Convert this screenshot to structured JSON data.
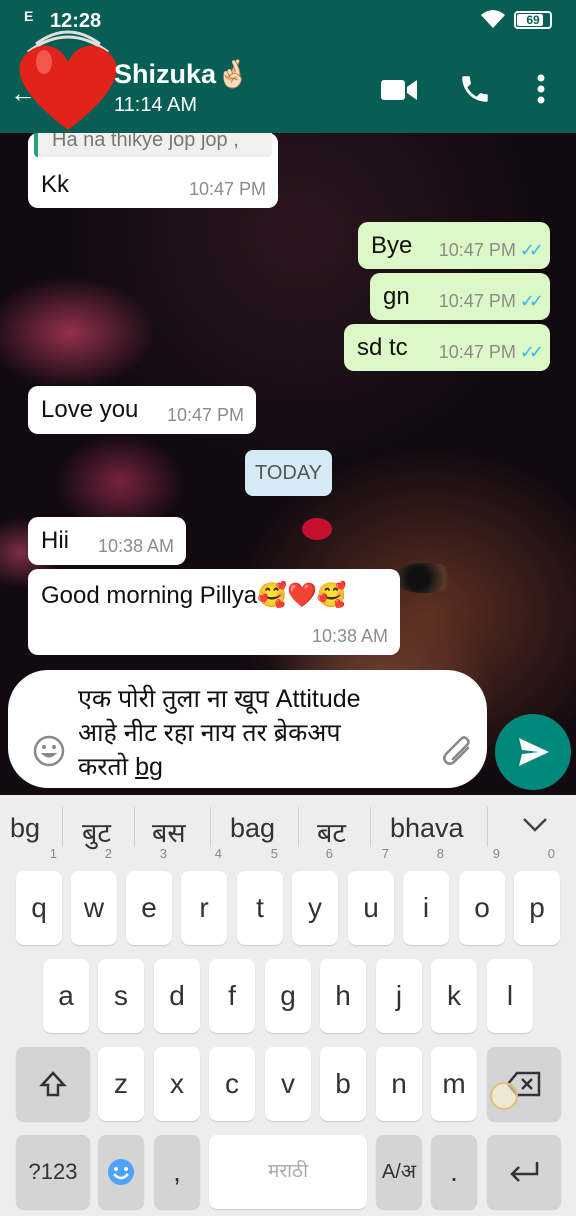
{
  "status_bar": {
    "time": "12:28",
    "signal": "E",
    "battery": "69"
  },
  "header": {
    "contact_name": "Shizuka🤞🏻",
    "last_seen": "11:14 AM",
    "icons": [
      "back-arrow-icon",
      "heart-icon",
      "video-call-icon",
      "voice-call-icon",
      "more-options-icon"
    ]
  },
  "chat": {
    "messages": [
      {
        "dir": "in",
        "quote": "Ha na thikye jop jop ,",
        "text": "Kk",
        "time": "10:47 PM"
      },
      {
        "dir": "out",
        "text": "Bye",
        "time": "10:47 PM",
        "ticks": "✓✓"
      },
      {
        "dir": "out",
        "text": "gn",
        "time": "10:47 PM",
        "ticks": "✓✓"
      },
      {
        "dir": "out",
        "text": "sd tc",
        "time": "10:47 PM",
        "ticks": "✓✓"
      },
      {
        "dir": "in",
        "text": "Love you",
        "time": "10:47 PM"
      },
      {
        "dir": "in",
        "text": "Hii",
        "time": "10:38 AM"
      },
      {
        "dir": "in",
        "text": "Good morning Pillya🥰❤️🥰",
        "time": "10:38 AM"
      }
    ],
    "date_divider": "TODAY"
  },
  "composer": {
    "line1": "एक पोरी तुला ना खूप Attitude",
    "line2": "आहे नीट रहा नाय तर ब्रेकअप",
    "line3_prefix": "करतो ",
    "line3_word": "bg"
  },
  "keyboard": {
    "suggestions": [
      "bg",
      "बुट",
      "बस",
      "bag",
      "बट",
      "bhava"
    ],
    "row1": [
      "q",
      "w",
      "e",
      "r",
      "t",
      "y",
      "u",
      "i",
      "o",
      "p"
    ],
    "row1_hints": [
      "1",
      "2",
      "3",
      "4",
      "5",
      "6",
      "7",
      "8",
      "9",
      "0"
    ],
    "row2": [
      "a",
      "s",
      "d",
      "f",
      "g",
      "h",
      "j",
      "k",
      "l"
    ],
    "row3": [
      "z",
      "x",
      "c",
      "v",
      "b",
      "n",
      "m"
    ],
    "symbols_label": "?123",
    "comma": ",",
    "space_label": "मराठी",
    "lang_toggle": "A/अ",
    "period": "."
  },
  "colors": {
    "header": "#075e54",
    "outgoing": "#dcf8c6",
    "send": "#00897b",
    "ticks": "#34b7f1"
  }
}
